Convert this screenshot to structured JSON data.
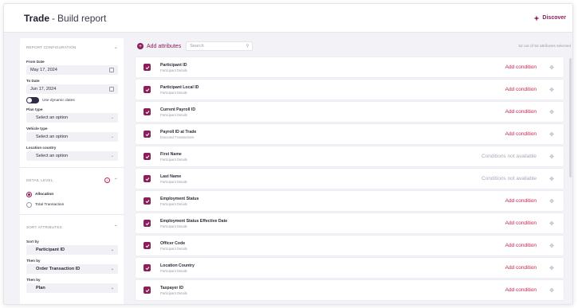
{
  "header": {
    "app_name": "Trade",
    "separator": "-",
    "page_title": "Build report",
    "discover_label": "Discover"
  },
  "colors": {
    "brand": "#8b1e5b",
    "condition": "#c0264f",
    "muted": "#9a9aaa"
  },
  "sidebar": {
    "report_config": {
      "title": "REPORT CONFIGURATION",
      "from_date_label": "From Date",
      "from_date_value": "May 17, 2024",
      "to_date_label": "To Date",
      "to_date_value": "Jun 17, 2024",
      "dynamic_dates_label": "Use dynamic dates",
      "plan_type_label": "Plan type",
      "plan_type_value": "Select an option",
      "vehicle_type_label": "Vehicle type",
      "vehicle_type_value": "Select an option",
      "location_country_label": "Location country",
      "location_country_value": "Select an option"
    },
    "detail_level": {
      "title": "DETAIL LEVEL",
      "info_icon": "!",
      "options": [
        "Allocation",
        "Total Transaction"
      ],
      "selected": "Allocation"
    },
    "sort_attributes": {
      "title": "SORT ATTRIBUTES",
      "sort_by_label": "Sort by",
      "sort_by_value": "Participant ID",
      "then_by_1_label": "Then by",
      "then_by_1_value": "Order Transaction ID",
      "then_by_2_label": "Then by",
      "then_by_2_value": "Plan"
    }
  },
  "main": {
    "add_attributes_label": "Add attributes",
    "search_placeholder": "Search",
    "selected_count": "52 out of 52 attributes selected",
    "attributes": [
      {
        "name": "Participant ID",
        "source": "Participant Details",
        "condition": "Add condition",
        "condition_available": true
      },
      {
        "name": "Participant Local ID",
        "source": "Participant Details",
        "condition": "Add condition",
        "condition_available": true
      },
      {
        "name": "Current Payroll ID",
        "source": "Participant Details",
        "condition": "Add condition",
        "condition_available": true
      },
      {
        "name": "Payroll ID at Trade",
        "source": "Executed Transactions",
        "condition": "Add condition",
        "condition_available": true
      },
      {
        "name": "First Name",
        "source": "Participant Details",
        "condition": "Conditions not available",
        "condition_available": false
      },
      {
        "name": "Last Name",
        "source": "Participant Details",
        "condition": "Conditions not available",
        "condition_available": false
      },
      {
        "name": "Employment Status",
        "source": "Participant Details",
        "condition": "Add condition",
        "condition_available": true
      },
      {
        "name": "Employment Status Effective Date",
        "source": "Participant Details",
        "condition": "Add condition",
        "condition_available": true
      },
      {
        "name": "Officer Code",
        "source": "Participant Details",
        "condition": "Add condition",
        "condition_available": true
      },
      {
        "name": "Location Country",
        "source": "Participant Details",
        "condition": "Add condition",
        "condition_available": true
      },
      {
        "name": "Taxpayer ID",
        "source": "Participant Details",
        "condition": "Add condition",
        "condition_available": true
      }
    ]
  }
}
